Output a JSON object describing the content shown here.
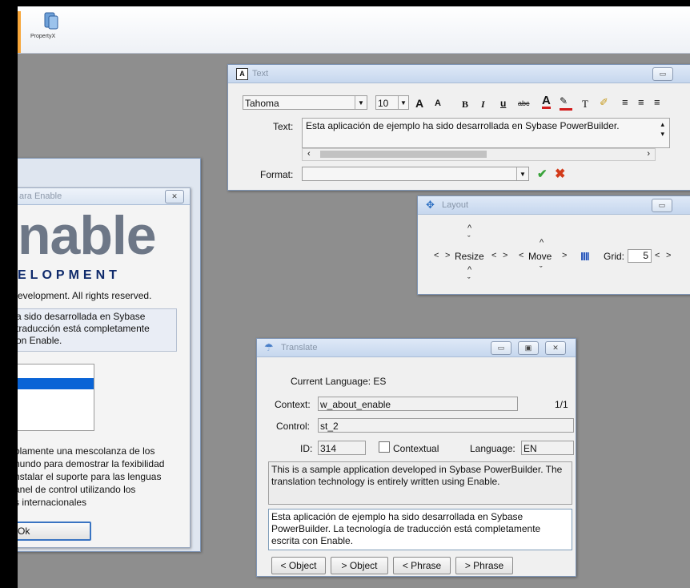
{
  "toolbar": {
    "propertyx_label": "PropertyX"
  },
  "text_window": {
    "title": "Text",
    "font_name": "Tahoma",
    "font_size": "10",
    "text_label": "Text:",
    "text_value": "Esta aplicación de ejemplo ha sido desarrollada en Sybase PowerBuilder.",
    "format_label": "Format:",
    "grow_font": "A",
    "shrink_font": "A",
    "bold": "B",
    "italic": "I",
    "underline": "u",
    "strike": "abc",
    "font_color": "A",
    "text_tool": "T"
  },
  "layout_window": {
    "title": "Layout",
    "resize_label": "Resize",
    "move_label": "Move",
    "grid_label": "Grid:",
    "grid_value": "5"
  },
  "about_window": {
    "title": "ara Enable",
    "logo_text": "nable",
    "logo_subtitle": "ELOPMENT",
    "copyright": "evelopment. All rights reserved.",
    "desc_lines": [
      "a sido desarrollada en Sybase",
      "traducción está completamente",
      "on Enable."
    ],
    "body_lines": [
      "olamente una mescolanza de los",
      "nundo para demostrar la fexibilidad",
      "nstalar el suporte para las lenguas",
      "anel de control utilizando los",
      "s internacionales"
    ],
    "ok_label": "Ok"
  },
  "translate_window": {
    "title": "Translate",
    "current_language": "Current Language: ES",
    "context_label": "Context:",
    "context_value": "w_about_enable",
    "counter": "1/1",
    "control_label": "Control:",
    "control_value": "st_2",
    "id_label": "ID:",
    "id_value": "314",
    "contextual_label": "Contextual",
    "language_label": "Language:",
    "language_value": "EN",
    "source_text": "This is a sample application developed in Sybase PowerBuilder. The translation technology is entirely written using Enable.",
    "translated_text": "Esta aplicación de ejemplo ha sido desarrollada en Sybase PowerBuilder. La tecnología de traducción está completamente escrita con Enable.",
    "prev_object": "< Object",
    "next_object": "> Object",
    "prev_phrase": "< Phrase",
    "next_phrase": "> Phrase"
  }
}
